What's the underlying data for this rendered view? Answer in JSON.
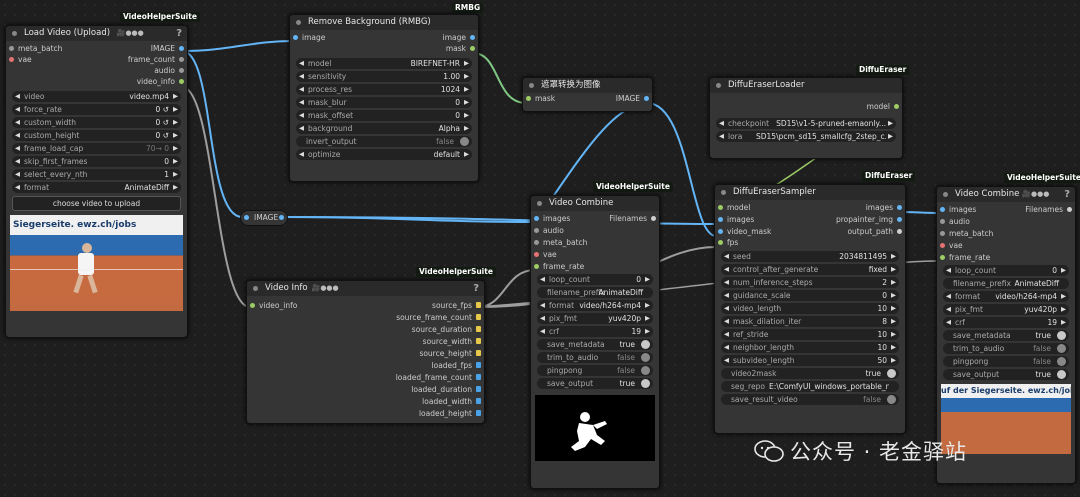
{
  "nodes": {
    "load_video": {
      "title": "Load Video (Upload)",
      "suite": "VideoHelperSuite",
      "inputs": [
        "meta_batch",
        "vae"
      ],
      "outputs": [
        "IMAGE",
        "frame_count",
        "audio",
        "video_info"
      ],
      "widgets": [
        {
          "label": "video",
          "value": "video.mp4"
        },
        {
          "label": "force_rate",
          "value": "0 ↺"
        },
        {
          "label": "custom_width",
          "value": "0 ↺"
        },
        {
          "label": "custom_height",
          "value": "0 ↺"
        },
        {
          "label": "frame_load_cap",
          "value": "70→ 0"
        },
        {
          "label": "skip_first_frames",
          "value": "0"
        },
        {
          "label": "select_every_nth",
          "value": "1"
        },
        {
          "label": "format",
          "value": "AnimateDiff"
        }
      ],
      "upload_button": "choose video to upload",
      "preview_text": "Siegerseite. ewz.ch/jobs"
    },
    "rmbg": {
      "title": "Remove Background (RMBG)",
      "suite": "RMBG",
      "inputs": [
        "image"
      ],
      "outputs": [
        "image",
        "mask"
      ],
      "widgets": [
        {
          "label": "model",
          "value": "BIREFNET-HR"
        },
        {
          "label": "sensitivity",
          "value": "1.00"
        },
        {
          "label": "process_res",
          "value": "1024"
        },
        {
          "label": "mask_blur",
          "value": "0"
        },
        {
          "label": "mask_offset",
          "value": "0"
        },
        {
          "label": "background",
          "value": "Alpha"
        },
        {
          "label": "invert_output",
          "value": "false"
        },
        {
          "label": "optimize",
          "value": "default"
        }
      ]
    },
    "mask_to_image": {
      "title": "遮罩转换为图像",
      "input": "mask",
      "output": "IMAGE"
    },
    "eraser_loader": {
      "title": "DiffuEraserLoader",
      "suite": "DiffuEraser",
      "output": "model",
      "widgets": [
        {
          "label": "checkpoint",
          "value": "SD15\\v1-5-pruned-emaonly..."
        },
        {
          "label": "lora",
          "value": "SD15\\pcm_sd15_smallcfg_2step_c..."
        }
      ]
    },
    "reroute": {
      "label": "IMAGE"
    },
    "video_info": {
      "title": "Video Info",
      "suite": "VideoHelperSuite",
      "input": "video_info",
      "outputs": [
        "source_fps",
        "source_frame_count",
        "source_duration",
        "source_width",
        "source_height",
        "loaded_fps",
        "loaded_frame_count",
        "loaded_duration",
        "loaded_width",
        "loaded_height"
      ]
    },
    "combine_mid": {
      "title": "Video Combine",
      "suite": "VideoHelperSuite",
      "inputs": [
        "images",
        "audio",
        "meta_batch",
        "vae",
        "frame_rate"
      ],
      "output": "Filenames",
      "widgets": [
        {
          "label": "loop_count",
          "value": "0",
          "kind": "num"
        },
        {
          "label": "filename_prefix",
          "value": "AnimateDiff",
          "kind": "txt"
        },
        {
          "label": "format",
          "value": "video/h264-mp4",
          "kind": "num"
        },
        {
          "label": "pix_fmt",
          "value": "yuv420p",
          "kind": "num"
        },
        {
          "label": "crf",
          "value": "19",
          "kind": "num"
        },
        {
          "label": "save_metadata",
          "value": "true",
          "kind": "tog",
          "on": true
        },
        {
          "label": "trim_to_audio",
          "value": "false",
          "kind": "tog",
          "on": false
        },
        {
          "label": "pingpong",
          "value": "false",
          "kind": "tog",
          "on": false
        },
        {
          "label": "save_output",
          "value": "true",
          "kind": "tog",
          "on": true
        }
      ]
    },
    "sampler": {
      "title": "DiffuEraserSampler",
      "suite": "DiffuEraser",
      "inputs": [
        "model",
        "images",
        "video_mask",
        "fps"
      ],
      "outputs": [
        "images",
        "propainter_img",
        "output_path"
      ],
      "widgets": [
        {
          "label": "seed",
          "value": "2034811495",
          "kind": "num"
        },
        {
          "label": "control_after_generate",
          "value": "fixed",
          "kind": "num"
        },
        {
          "label": "num_inference_steps",
          "value": "2",
          "kind": "num"
        },
        {
          "label": "guidance_scale",
          "value": "0",
          "kind": "num"
        },
        {
          "label": "video_length",
          "value": "10",
          "kind": "num"
        },
        {
          "label": "mask_dilation_iter",
          "value": "8",
          "kind": "num"
        },
        {
          "label": "ref_stride",
          "value": "10",
          "kind": "num"
        },
        {
          "label": "neighbor_length",
          "value": "10",
          "kind": "num"
        },
        {
          "label": "subvideo_length",
          "value": "50",
          "kind": "num"
        },
        {
          "label": "video2mask",
          "value": "true",
          "kind": "tog",
          "on": true
        },
        {
          "label": "seg_repo",
          "value": "E:\\ComfyUI_windows_portable_nv",
          "kind": "txt"
        },
        {
          "label": "save_result_video",
          "value": "false",
          "kind": "tog",
          "on": false
        }
      ]
    },
    "combine_right": {
      "title": "Video Combine",
      "suite": "VideoHelperSuite",
      "inputs": [
        "images",
        "audio",
        "meta_batch",
        "vae",
        "frame_rate"
      ],
      "output": "Filenames",
      "widgets": [
        {
          "label": "loop_count",
          "value": "0",
          "kind": "num"
        },
        {
          "label": "filename_prefix",
          "value": "AnimateDiff",
          "kind": "txt"
        },
        {
          "label": "format",
          "value": "video/h264-mp4",
          "kind": "num"
        },
        {
          "label": "pix_fmt",
          "value": "yuv420p",
          "kind": "num"
        },
        {
          "label": "crf",
          "value": "19",
          "kind": "num"
        },
        {
          "label": "save_metadata",
          "value": "true",
          "kind": "tog",
          "on": true
        },
        {
          "label": "trim_to_audio",
          "value": "false",
          "kind": "tog",
          "on": false
        },
        {
          "label": "pingpong",
          "value": "false",
          "kind": "tog",
          "on": false
        },
        {
          "label": "save_output",
          "value": "true",
          "kind": "tog",
          "on": true
        }
      ],
      "preview_text": "uf der Siegerseite. ewz.ch/jobs"
    }
  },
  "watermark": "公众号 · 老金驿站",
  "colors": {
    "image_wire": "#64b5f6",
    "mask_wire": "#81c784",
    "info_wire": "#9e9e9e"
  }
}
